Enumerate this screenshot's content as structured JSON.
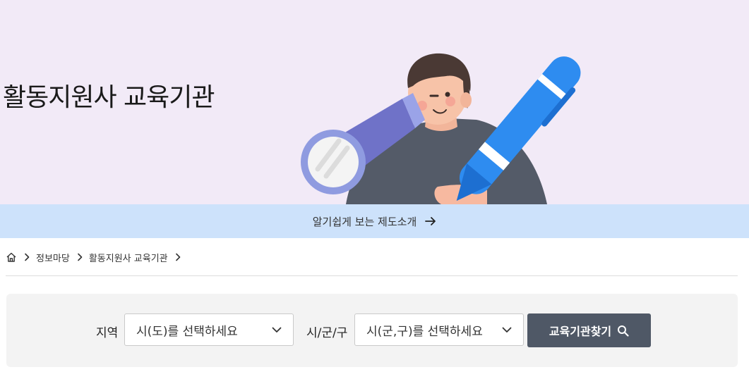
{
  "hero": {
    "title": "활동지원사 교육기관",
    "background_color": "#f2eaf7",
    "illustration": "person-with-telescope-and-pen-illustration"
  },
  "intro_bar": {
    "label": "알기쉽게 보는 제도소개",
    "icon": "arrow-right-icon",
    "background_color": "#cde2fb"
  },
  "breadcrumb": {
    "home_icon": "home-icon",
    "items": [
      "정보마당",
      "활동지원사 교육기관"
    ],
    "separator_icon": "chevron-right-icon"
  },
  "search": {
    "region_label": "지역",
    "region_select": "시(도)를 선택하세요",
    "district_label": "시/군/구",
    "district_select": "시(군,구)를 선택하세요",
    "button_label": "교육기관찾기",
    "button_icon": "search-icon",
    "button_color": "#4f5866"
  }
}
